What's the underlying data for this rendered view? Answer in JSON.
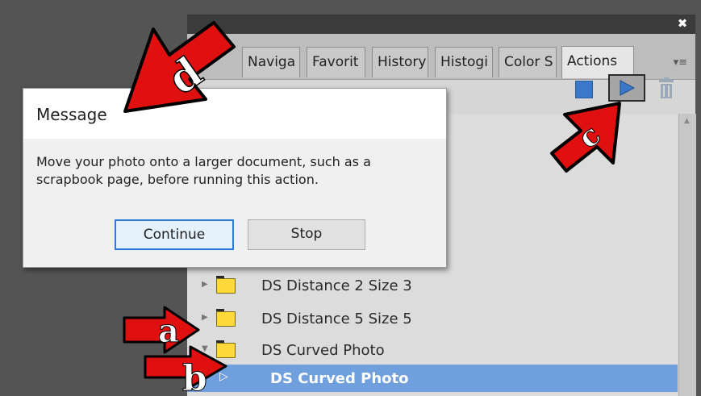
{
  "panel": {
    "close_icon": "close-icon",
    "tabs": [
      {
        "label": "Naviga"
      },
      {
        "label": "Favorit"
      },
      {
        "label": "History"
      },
      {
        "label": "Histogi"
      },
      {
        "label": "Color S"
      },
      {
        "label": "Actions"
      }
    ],
    "active_tab": "Actions",
    "menu_icon": "panel-menu-icon"
  },
  "toolbar": {
    "stop_icon": "stop-square-icon",
    "play_icon": "play-triangle-icon",
    "trash_icon": "trash-icon",
    "accent_color": "#3b78c9"
  },
  "actions_list": [
    {
      "label": "DS Distance 2 Size 3",
      "type": "folder",
      "expanded": false
    },
    {
      "label": "DS Distance 5 Size 5",
      "type": "folder",
      "expanded": false
    },
    {
      "label": "DS Curved Photo",
      "type": "folder",
      "expanded": true
    },
    {
      "label": "DS Curved Photo",
      "type": "action",
      "selected": true
    }
  ],
  "dialog": {
    "title": "Message",
    "message": "Move your photo onto a larger document, such as a scrapbook page, before running this action.",
    "continue_label": "Continue",
    "stop_label": "Stop"
  },
  "annotations": {
    "a": "a",
    "b": "b",
    "c": "c",
    "d": "d",
    "arrow_color": "#e01010"
  }
}
